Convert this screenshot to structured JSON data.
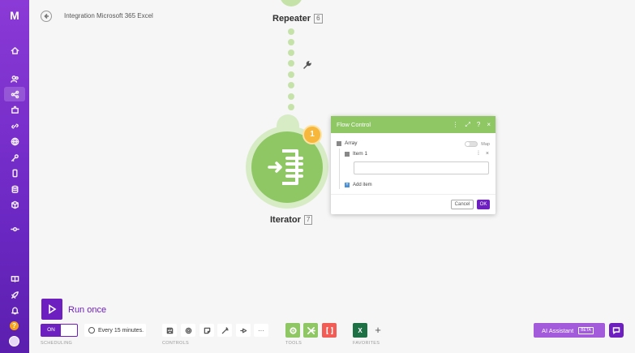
{
  "app": {
    "logo_text": "M"
  },
  "header": {
    "scenario_title": "Integration Microsoft 365 Excel"
  },
  "sidebar": {
    "items": [
      {
        "icon": "home-icon"
      },
      {
        "icon": "users-icon"
      },
      {
        "icon": "share-icon"
      },
      {
        "icon": "puzzle-icon"
      },
      {
        "icon": "link-icon"
      },
      {
        "icon": "globe-icon"
      },
      {
        "icon": "key-icon"
      },
      {
        "icon": "device-icon"
      },
      {
        "icon": "database-icon"
      },
      {
        "icon": "box-icon"
      },
      {
        "icon": "flow-icon"
      },
      {
        "icon": "book-icon"
      },
      {
        "icon": "rocket-icon"
      },
      {
        "icon": "bell-icon"
      }
    ],
    "help_label": "?"
  },
  "canvas": {
    "repeater": {
      "label": "Repeater",
      "id": "6"
    },
    "iterator": {
      "label": "Iterator",
      "id": "7",
      "badge": "1"
    }
  },
  "dialog": {
    "title": "Flow Control",
    "tools": [
      "⋮",
      "⤢",
      "?",
      "×"
    ],
    "array_label": "Array",
    "map_label": "Map",
    "item_label": "Item 1",
    "item_value": "",
    "add_item_label": "Add item",
    "cancel_label": "Cancel",
    "ok_label": "OK"
  },
  "toolbar": {
    "run_label": "Run once",
    "toggle_label": "ON",
    "schedule_text": "Every 15 minutes.",
    "scheduling_label": "SCHEDULING",
    "controls_label": "CONTROLS",
    "tools_label": "TOOLS",
    "favorites_label": "FAVORITES",
    "more_label": "···",
    "favorite_excel_label": "X",
    "add_favorite_label": "+",
    "ai_label": "AI Assistant",
    "beta_label": "BETA"
  },
  "colors": {
    "brand": "#6d1fbf",
    "module_green": "#8fc765",
    "badge": "#f6b73c"
  }
}
